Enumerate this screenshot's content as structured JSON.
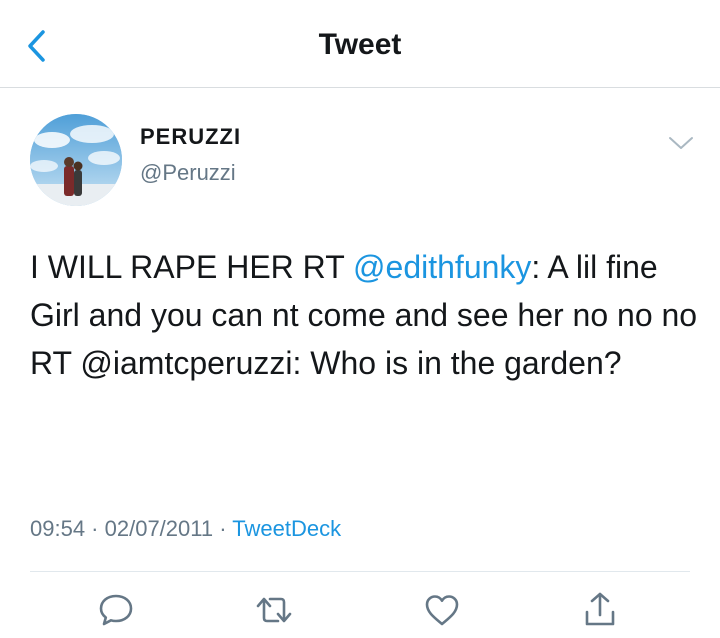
{
  "header": {
    "title": "Tweet"
  },
  "user": {
    "display_name": "PERUZZI",
    "handle": "@Peruzzi"
  },
  "tweet": {
    "text_1": "I WILL RAPE HER RT ",
    "mention_1": "@edithfunky",
    "text_2": ": A lil fine Girl and you can nt come and see her no no no RT @iamtcperuzzi: Who is in the garden?",
    "time": "09:54",
    "date": "02/07/2011",
    "source": "TweetDeck",
    "separator": " · "
  },
  "colors": {
    "accent": "#1b95e0",
    "secondary_text": "#657786",
    "primary_text": "#14171a"
  },
  "icons": [
    "back-chevron-icon",
    "caret-down-icon",
    "reply-icon",
    "retweet-icon",
    "like-icon",
    "share-icon"
  ]
}
